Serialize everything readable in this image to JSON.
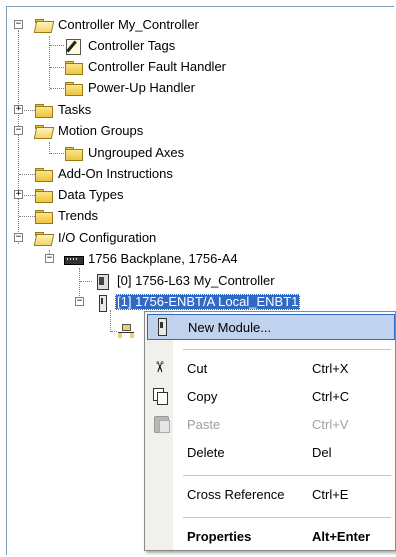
{
  "tree": {
    "nodes": [
      {
        "label": "Controller My_Controller",
        "icon": "folder-open-icon",
        "expander": "−"
      },
      {
        "label": "Controller Tags",
        "icon": "controller-tags-icon"
      },
      {
        "label": "Controller Fault Handler",
        "icon": "folder-icon"
      },
      {
        "label": "Power-Up Handler",
        "icon": "folder-icon"
      },
      {
        "label": "Tasks",
        "icon": "folder-icon",
        "expander": "+"
      },
      {
        "label": "Motion Groups",
        "icon": "folder-open-icon",
        "expander": "−"
      },
      {
        "label": "Ungrouped Axes",
        "icon": "folder-icon"
      },
      {
        "label": "Add-On Instructions",
        "icon": "folder-icon"
      },
      {
        "label": "Data Types",
        "icon": "folder-icon",
        "expander": "+"
      },
      {
        "label": "Trends",
        "icon": "folder-icon"
      },
      {
        "label": "I/O Configuration",
        "icon": "folder-open-icon",
        "expander": "−"
      },
      {
        "label": "1756 Backplane, 1756-A4",
        "icon": "backplane-icon",
        "expander": "−"
      },
      {
        "label": "[0] 1756-L63 My_Controller",
        "icon": "controller-module-icon"
      },
      {
        "label": "[1] 1756-ENBT/A Local_ENBT1",
        "icon": "ethernet-module-icon",
        "expander": "−",
        "selected": true
      },
      {
        "label": "",
        "icon": "ethernet-network-icon"
      }
    ]
  },
  "context_menu": {
    "items": [
      {
        "label": "New Module...",
        "shortcut": "",
        "icon": "new-module-icon",
        "state": "hover"
      },
      {
        "label": "Cut",
        "shortcut": "Ctrl+X",
        "icon": "cut-icon",
        "state": "normal"
      },
      {
        "label": "Copy",
        "shortcut": "Ctrl+C",
        "icon": "copy-icon",
        "state": "normal"
      },
      {
        "label": "Paste",
        "shortcut": "Ctrl+V",
        "icon": "paste-icon",
        "state": "disabled"
      },
      {
        "label": "Delete",
        "shortcut": "Del",
        "icon": "",
        "state": "normal"
      },
      {
        "label": "Cross Reference",
        "shortcut": "Ctrl+E",
        "icon": "",
        "state": "normal"
      },
      {
        "label": "Properties",
        "shortcut": "Alt+Enter",
        "icon": "",
        "state": "bold"
      }
    ]
  },
  "colors": {
    "selection": "#316ac5",
    "menu_hover": "#c1d2ee",
    "disabled_text": "#a0a0a0"
  }
}
